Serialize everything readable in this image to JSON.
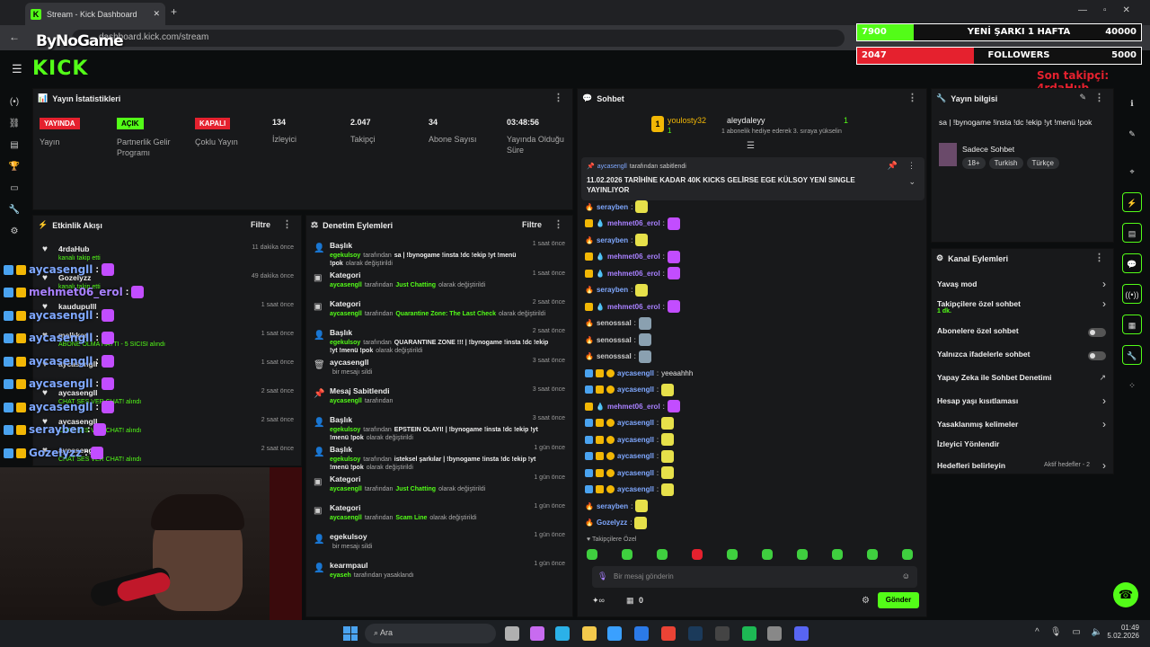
{
  "browser": {
    "tab_title": "Stream - Kick Dashboard",
    "url": "dashboard.kick.com/stream",
    "watermark": "ByNoGame"
  },
  "kick": {
    "logo": "KICK"
  },
  "goals": [
    {
      "current": "7900",
      "label": "YENİ ŞARKI 1 HAFTA",
      "target": "40000",
      "color": "#53fc18",
      "progress": 0.2
    },
    {
      "current": "2047",
      "label": "FOLLOWERS",
      "target": "5000",
      "color": "#e5212e",
      "progress": 0.41
    }
  ],
  "last_follower": "Son takipçi: 4rdaHub",
  "stats": {
    "title": "Yayın İstatistikleri",
    "items": [
      {
        "badge": "YAYINDA",
        "badge_bg": "#e5212e",
        "badge_fg": "#fff",
        "label": "Yayın"
      },
      {
        "badge": "AÇIK",
        "badge_bg": "#53fc18",
        "badge_fg": "#000",
        "label": "Partnerlik Gelir Programı"
      },
      {
        "badge": "KAPALI",
        "badge_bg": "#e5212e",
        "badge_fg": "#fff",
        "label": "Çoklu Yayın"
      },
      {
        "num": "134",
        "label": "İzleyici"
      },
      {
        "num": "2.047",
        "label": "Takipçi"
      },
      {
        "num": "34",
        "label": "Abone Sayısı"
      },
      {
        "num": "03:48:56",
        "label": "Yayında Olduğu Süre"
      }
    ]
  },
  "activity": {
    "title": "Etkinlik Akışı",
    "filter": "Filtre",
    "items": [
      {
        "user": "4rdaHub",
        "action": "kanalı takip etti",
        "time": "11 dakika önce"
      },
      {
        "user": "Gozelyzz",
        "action": "kanalı takip etti",
        "time": "49 dakika önce"
      },
      {
        "user": "kaudupulll",
        "action": "",
        "time": "1 saat önce"
      },
      {
        "user": "melkkar",
        "action": "ABONE OLMA HATTI - 5 SICISI alındı",
        "time": "1 saat önce"
      },
      {
        "user": "aycasengll",
        "action": "",
        "time": "1 saat önce"
      },
      {
        "user": "aycasengll",
        "action": "CHAT SES VER CHAT! alındı",
        "time": "2 saat önce"
      },
      {
        "user": "aycasengll",
        "action": "CHAT SES VER CHAT! alındı",
        "time": "2 saat önce"
      },
      {
        "user": "aycasengll",
        "action": "CHAT SES VER CHAT! alındı",
        "time": "2 saat önce"
      }
    ]
  },
  "overlay_names": [
    {
      "name": "aycasengll",
      "color": "#7fa8ff"
    },
    {
      "name": "mehmet06_erol",
      "color": "#a880ff"
    },
    {
      "name": "aycasengll",
      "color": "#7fa8ff"
    },
    {
      "name": "aycasengll",
      "color": "#7fa8ff"
    },
    {
      "name": "aycasengll",
      "color": "#7fa8ff"
    },
    {
      "name": "aycasengll",
      "color": "#7fa8ff"
    },
    {
      "name": "aycasengll",
      "color": "#7fa8ff"
    },
    {
      "name": "serayben",
      "color": "#7fa8ff"
    },
    {
      "name": "Gozelyzz",
      "color": "#7fa8ff"
    }
  ],
  "moderation": {
    "title": "Denetim Eylemleri",
    "filter": "Filtre",
    "items": [
      {
        "icon": "person",
        "title": "Başlık",
        "user": "egekulsoy",
        "mid": "tarafından",
        "val": "sa | !bynogame !insta !dc !ekip !yt !menü !pok",
        "tail": "olarak değiştirildi",
        "time": "1 saat önce"
      },
      {
        "icon": "box",
        "title": "Kategori",
        "user": "aycasengll",
        "mid": "tarafından",
        "val": "Just Chatting",
        "tail": "olarak değiştirildi",
        "time": "1 saat önce"
      },
      {
        "icon": "box",
        "title": "Kategori",
        "user": "aycasengll",
        "mid": "tarafından",
        "val": "Quarantine Zone: The Last Check",
        "tail": "olarak değiştirildi",
        "time": "2 saat önce"
      },
      {
        "icon": "person",
        "title": "Başlık",
        "user": "egekulsoy",
        "mid": "tarafından",
        "val": "QUARANTINE ZONE !!! | !bynogame !insta !dc !ekip !yt !menü !pok",
        "tail": "olarak değiştirildi",
        "time": "2 saat önce"
      },
      {
        "icon": "trash",
        "title": "aycasengll",
        "user": "",
        "mid": "bir mesajı sildi",
        "val": "",
        "tail": "",
        "time": "3 saat önce"
      },
      {
        "icon": "pin",
        "title": "Mesaj Sabitlendi",
        "user": "aycasengll",
        "mid": "tarafından",
        "val": "",
        "tail": "",
        "time": "3 saat önce"
      },
      {
        "icon": "person",
        "title": "Başlık",
        "user": "egekulsoy",
        "mid": "tarafından",
        "val": "EPSTEIN OLAYI! | !bynogame !insta !dc !ekip !yt !menü !pok",
        "tail": "olarak değiştirildi",
        "time": "3 saat önce"
      },
      {
        "icon": "person",
        "title": "Başlık",
        "user": "egekulsoy",
        "mid": "tarafından",
        "val": "isteksel şarkılar | !bynogame !insta !dc !ekip !yt !menü !pok",
        "tail": "olarak değiştirildi",
        "time": "1 gün önce"
      },
      {
        "icon": "box",
        "title": "Kategori",
        "user": "aycasengll",
        "mid": "tarafından",
        "val": "Just Chatting",
        "tail": "olarak değiştirildi",
        "time": "1 gün önce"
      },
      {
        "icon": "box",
        "title": "Kategori",
        "user": "aycasengll",
        "mid": "tarafından",
        "val": "Scam Line",
        "tail": "olarak değiştirildi",
        "time": "1 gün önce"
      },
      {
        "icon": "person",
        "title": "egekulsoy",
        "user": "",
        "mid": "bir mesajı sildi",
        "val": "",
        "tail": "",
        "time": "1 gün önce"
      },
      {
        "icon": "person",
        "title": "kearmpaul",
        "user": "eyaseh",
        "mid": "tarafından yasaklandı",
        "val": "",
        "tail": "",
        "time": "1 gün önce"
      }
    ]
  },
  "chat": {
    "title": "Sohbet",
    "gift": {
      "from": "youlosty32",
      "to": "aleydaleyy",
      "text": "1 abonelik hediye ederek 3. sıraya yükselin",
      "count_left": "1",
      "count_right": "1"
    },
    "pinned": {
      "by": "aycasengll",
      "by_text": "tarafından sabitlendi",
      "msg": "11.02.2026 TARİHİNE KADAR 40K KICKS GELİRSE EGE KÜLSOY YENİ SINGLE YAYINLIYOR"
    },
    "messages": [
      {
        "user": "serayben",
        "color": "#7fa8ff",
        "text": ""
      },
      {
        "user": "mehmet06_erol",
        "color": "#a880ff",
        "text": ""
      },
      {
        "user": "serayben",
        "color": "#7fa8ff",
        "text": ""
      },
      {
        "user": "mehmet06_erol",
        "color": "#a880ff",
        "text": ""
      },
      {
        "user": "mehmet06_erol",
        "color": "#a880ff",
        "text": ""
      },
      {
        "user": "serayben",
        "color": "#7fa8ff",
        "text": ""
      },
      {
        "user": "mehmet06_erol",
        "color": "#a880ff",
        "text": ""
      },
      {
        "user": "senosssal",
        "color": "#ccc",
        "text": ""
      },
      {
        "user": "senosssal",
        "color": "#ccc",
        "text": ""
      },
      {
        "user": "senosssal",
        "color": "#ccc",
        "text": ""
      },
      {
        "user": "aycasengll",
        "color": "#7fa8ff",
        "text": "yeeaahhh"
      },
      {
        "user": "aycasengll",
        "color": "#7fa8ff",
        "text": ""
      },
      {
        "user": "mehmet06_erol",
        "color": "#a880ff",
        "text": ""
      },
      {
        "user": "aycasengll",
        "color": "#7fa8ff",
        "text": ""
      },
      {
        "user": "aycasengll",
        "color": "#7fa8ff",
        "text": ""
      },
      {
        "user": "aycasengll",
        "color": "#7fa8ff",
        "text": ""
      },
      {
        "user": "aycasengll",
        "color": "#7fa8ff",
        "text": ""
      },
      {
        "user": "aycasengll",
        "color": "#7fa8ff",
        "text": ""
      },
      {
        "user": "serayben",
        "color": "#7fa8ff",
        "text": ""
      },
      {
        "user": "Gozelyzz",
        "color": "#7fa8ff",
        "text": ""
      }
    ],
    "followers_only": "Takipçilere Özel",
    "placeholder": "Bir mesaj gönderin",
    "points": "0",
    "send": "Gönder"
  },
  "stream_info": {
    "title": "Yayın bilgisi",
    "stream_title": "sa | !bynogame !insta !dc !ekip !yt !menü !pok",
    "category": "Sadece Sohbet",
    "tags": [
      "18+",
      "Turkish",
      "Türkçe"
    ]
  },
  "channel_actions": {
    "title": "Kanal Eylemleri",
    "items": [
      {
        "label": "Yavaş mod",
        "sub": "",
        "ctrl": "chev"
      },
      {
        "label": "Takipçilere özel sohbet",
        "sub": "1 dk.",
        "ctrl": "chev"
      },
      {
        "label": "Abonelere özel sohbet",
        "sub": "",
        "ctrl": "toggle"
      },
      {
        "label": "Yalnızca ifadelerle sohbet",
        "sub": "",
        "ctrl": "toggle"
      },
      {
        "label": "Yapay Zeka ile Sohbet Denetimi",
        "sub": "",
        "ctrl": "ext"
      },
      {
        "label": "Hesap yaşı kısıtlaması",
        "sub": "",
        "ctrl": "chev"
      },
      {
        "label": "Yasaklanmış kelimeler",
        "sub": "",
        "ctrl": "chev"
      },
      {
        "label": "İzleyici Yönlendir",
        "sub": "",
        "ctrl": ""
      },
      {
        "label": "Hedefleri belirleyin",
        "sub": "",
        "ctrl": "chev",
        "extra": "Aktif hedefler - 2"
      }
    ]
  },
  "taskbar": {
    "search": "Ara",
    "time": "01:49",
    "date": "5.02.2026"
  }
}
